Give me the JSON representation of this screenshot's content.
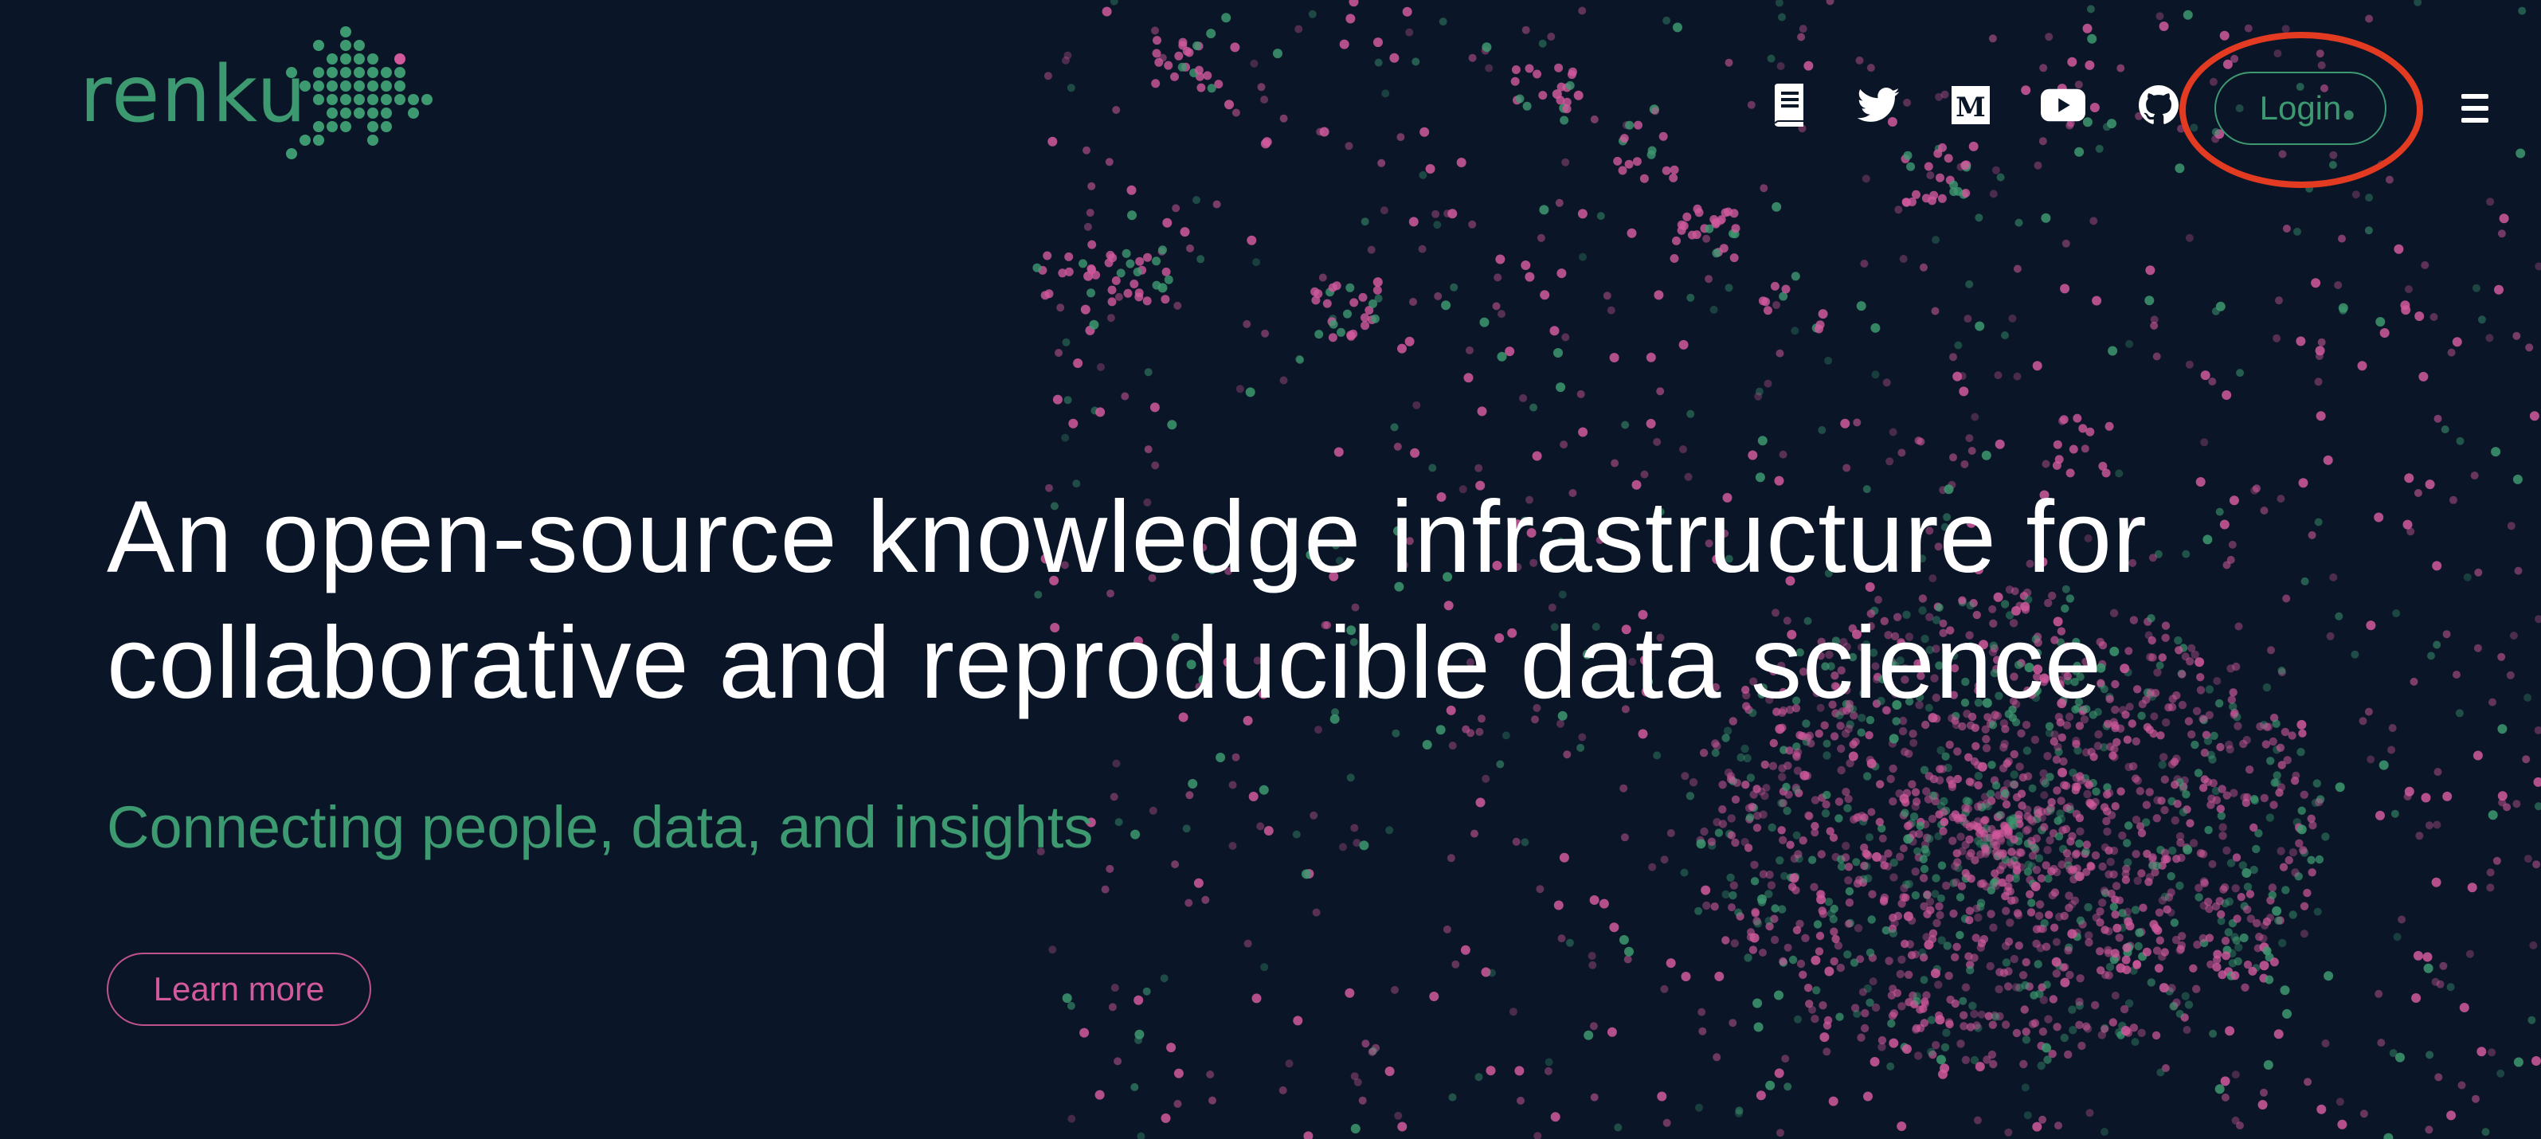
{
  "brand": {
    "name": "renku",
    "primary_color": "#3d9970",
    "accent_color": "#d1599c",
    "background_color": "#0a1628"
  },
  "header": {
    "icons": [
      {
        "name": "book-icon",
        "label": "Documentation"
      },
      {
        "name": "twitter-icon",
        "label": "Twitter"
      },
      {
        "name": "medium-icon",
        "label": "Medium"
      },
      {
        "name": "youtube-icon",
        "label": "YouTube"
      },
      {
        "name": "github-icon",
        "label": "GitHub"
      }
    ],
    "login_label": "Login",
    "menu_icon": "hamburger-menu-icon"
  },
  "hero": {
    "title_line1": "An open-source knowledge infrastructure for",
    "title_line2": "collaborative and reproducible data science",
    "subtitle": "Connecting people, data, and insights",
    "cta_label": "Learn more"
  },
  "annotation": {
    "highlight_color": "#e33a22",
    "highlight_target": "login-button"
  }
}
